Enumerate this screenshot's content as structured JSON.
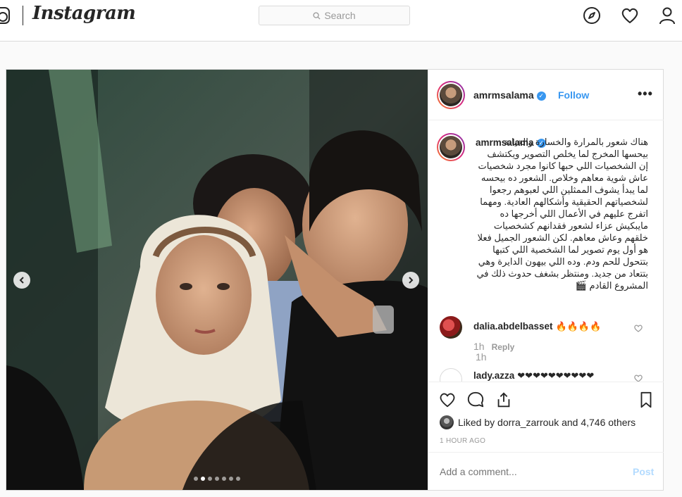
{
  "nav": {
    "wordmark": "Instagram",
    "search_placeholder": "Search",
    "icons": [
      "instagram-glyph-icon",
      "compass-icon",
      "heart-icon",
      "profile-icon"
    ]
  },
  "post": {
    "author": "amrmsalama",
    "verified": true,
    "follow_label": "Follow",
    "more_label": "•••",
    "caption": "هناك شعور بالمرارة والخسارة والخيانة بيحسها المخرج لما يخلص التصوير ويكتشف إن الشخصيات اللي حبها كانوا مجرد شخصيات عاش شوية معاهم وخلاص. الشعور ده بيحسه لما يبدأ يشوف الممثلين اللي لعبوهم رجعوا لشخصياتهم الحقيقية وأشكالهم العادية. ومهما اتفرج عليهم في الأعمال اللي أخرجها ده مايبكيش عزاء لشعور فقدانهم كشخصيات خلقهم وعاش معاهم. لكن الشعور الجميل فعلا هو أول يوم تصوير لما الشخصية اللي كتبها بتتحول للحم ودم. وده اللي بيهون الدايرة وهي بتتعاد من جديد. ومنتظر بشغف حدوث ذلك في المشروع القادم 🎬",
    "caption_time": "1h",
    "comments": [
      {
        "user": "dalia.abdelbasset",
        "text": "🔥🔥🔥🔥",
        "time": "1h",
        "reply_label": "Reply"
      },
      {
        "user": "lady.azza",
        "text": "❤❤❤❤❤❤❤❤❤❤"
      }
    ],
    "carousel": {
      "count": 7,
      "active_index": 1
    },
    "liked_by_prefix": "Liked by",
    "liked_by_user": "dorra_zarrouk",
    "liked_by_and": "and",
    "liked_by_others": "4,746 others",
    "time_ago": "1 HOUR AGO",
    "add_comment_placeholder": "Add a comment...",
    "post_label": "Post"
  },
  "colors": {
    "link": "#3897f0",
    "post_disabled": "#b3dbff",
    "border": "#dbdbdb"
  }
}
